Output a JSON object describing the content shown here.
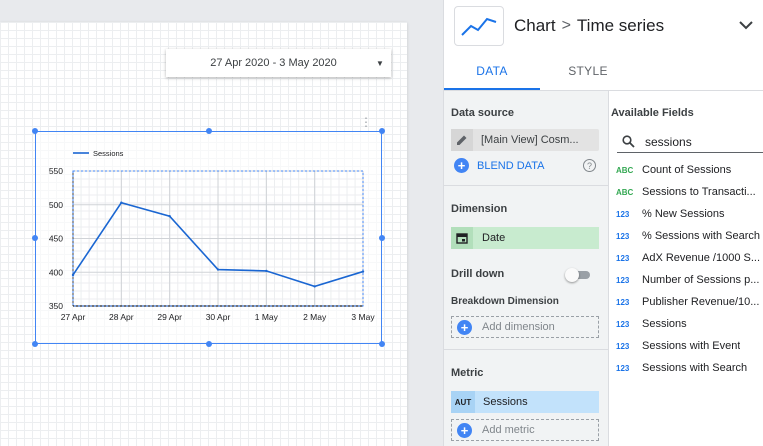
{
  "date_range": {
    "label": "27 Apr 2020 - 3 May 2020"
  },
  "chart_data": {
    "type": "line",
    "categories": [
      "27 Apr",
      "28 Apr",
      "29 Apr",
      "30 Apr",
      "1 May",
      "2 May",
      "3 May"
    ],
    "series": [
      {
        "name": "Sessions",
        "values": [
          396,
          503,
          483,
          404,
          402,
          379,
          401
        ]
      }
    ],
    "ylim": [
      350,
      550
    ],
    "yticks": [
      "550",
      "500",
      "450",
      "400",
      "350"
    ],
    "legend": "top-left",
    "grid": true,
    "line_color": "#1a66d2"
  },
  "panel": {
    "breadcrumb_root": "Chart",
    "breadcrumb_sep": ">",
    "breadcrumb_leaf": "Time series",
    "tabs": {
      "data": "DATA",
      "style": "STYLE"
    },
    "data_source": {
      "title": "Data source",
      "name": "[Main View] Cosm...",
      "blend_label": "BLEND DATA",
      "help": "?"
    },
    "dimension": {
      "title": "Dimension",
      "value": "Date",
      "drill_down": "Drill down",
      "breakdown_title": "Breakdown Dimension",
      "add_label": "Add dimension"
    },
    "metric": {
      "title": "Metric",
      "badge": "AUT",
      "value": "Sessions",
      "add_label": "Add metric"
    },
    "available": {
      "title": "Available Fields",
      "search_value": "sessions",
      "fields": [
        {
          "type": "ABC",
          "kind": "dim",
          "name": "Count of Sessions"
        },
        {
          "type": "ABC",
          "kind": "dim",
          "name": "Sessions to Transacti..."
        },
        {
          "type": "123",
          "kind": "met",
          "name": "% New Sessions"
        },
        {
          "type": "123",
          "kind": "met",
          "name": "% Sessions with Search"
        },
        {
          "type": "123",
          "kind": "met",
          "name": "AdX Revenue /1000 S..."
        },
        {
          "type": "123",
          "kind": "met",
          "name": "Number of Sessions p..."
        },
        {
          "type": "123",
          "kind": "met",
          "name": "Publisher Revenue/10..."
        },
        {
          "type": "123",
          "kind": "met",
          "name": "Sessions"
        },
        {
          "type": "123",
          "kind": "met",
          "name": "Sessions with Event"
        },
        {
          "type": "123",
          "kind": "met",
          "name": "Sessions with Search"
        }
      ]
    }
  }
}
